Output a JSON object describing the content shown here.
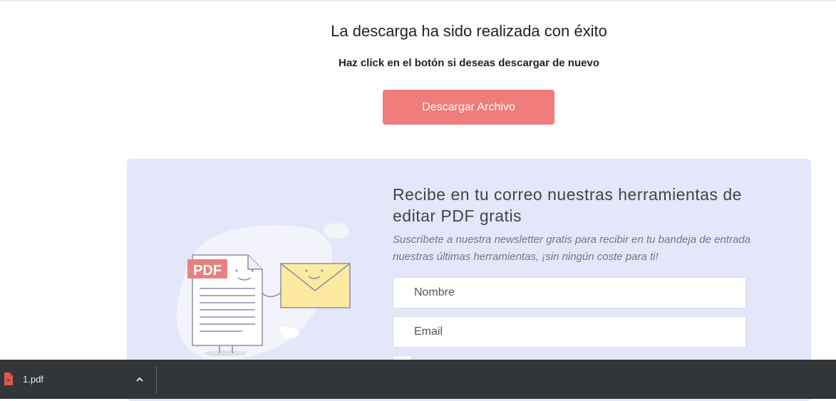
{
  "main": {
    "title": "La descarga ha sido realizada con éxito",
    "subtitle": "Haz click en el botón si deseas descargar de nuevo",
    "download_button": "Descargar Archivo"
  },
  "newsletter": {
    "title": "Recibe en tu correo nuestras herramientas de editar PDF gratis",
    "description": "Suscríbete a nuestra newsletter gratis para recibir en tu bandeja de entrada nuestras últimas herramientas, ¡sin ningún coste para ti!",
    "name_placeholder": "Nombre",
    "email_placeholder": "Email",
    "illustration_label": "PDF"
  },
  "download_bar": {
    "file_name": "1.pdf"
  },
  "colors": {
    "button": "#ef7b7b",
    "panel": "#e4e6fa",
    "download_bar": "#323639"
  },
  "icons": [
    "pdf-file-icon",
    "chevron-up-icon",
    "envelope-icon"
  ]
}
